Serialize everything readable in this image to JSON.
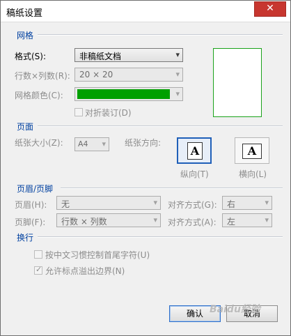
{
  "window": {
    "title": "稿纸设置",
    "close_glyph": "✕"
  },
  "sections": {
    "grid": "网格",
    "page": "页面",
    "header_footer": "页眉/页脚",
    "line_break": "换行"
  },
  "grid": {
    "format_label": "格式(S):",
    "format_value": "非稿纸文档",
    "rows_cols_label": "行数×列数(R):",
    "rows_cols_value": "20 × 20",
    "color_label": "网格颜色(C):",
    "color_value": "#00a000",
    "fold_label": "对折装订(D)"
  },
  "page": {
    "size_label": "纸张大小(Z):",
    "size_value": "A4",
    "orientation_label": "纸张方向:",
    "portrait_label": "纵向(T)",
    "landscape_label": "横向(L)",
    "paper_glyph": "A"
  },
  "header_footer": {
    "header_label": "页眉(H):",
    "header_value": "无",
    "header_align_label": "对齐方式(G):",
    "header_align_value": "右",
    "footer_label": "页脚(F):",
    "footer_value": "行数 × 列数",
    "footer_align_label": "对齐方式(A):",
    "footer_align_value": "左"
  },
  "line_break": {
    "opt1_label": "按中文习惯控制首尾字符(U)",
    "opt1_checked": false,
    "opt2_label": "允许标点溢出边界(N)",
    "opt2_checked": true
  },
  "buttons": {
    "ok": "确认",
    "cancel": "取消"
  },
  "watermark": "Baidu经验"
}
